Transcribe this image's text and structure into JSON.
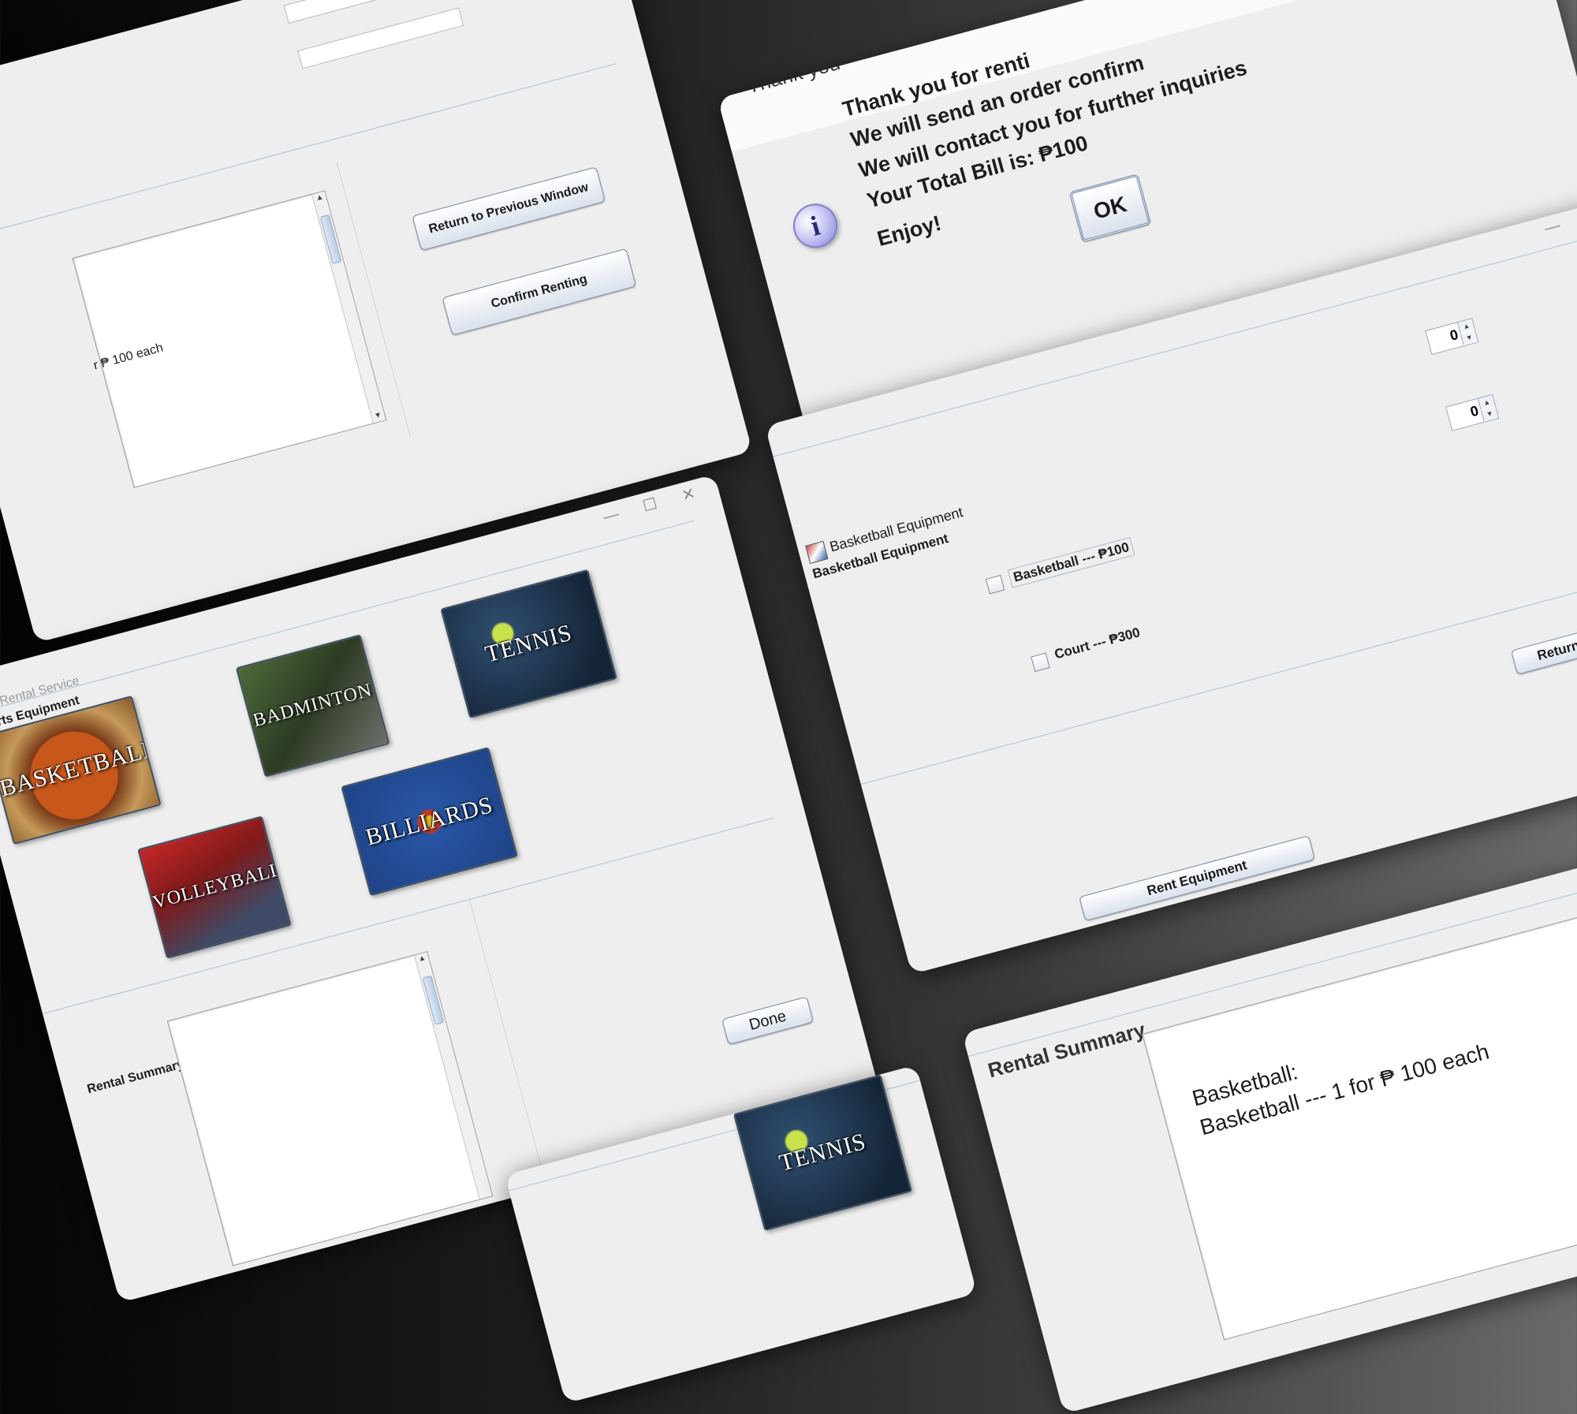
{
  "windows": {
    "customer_form": {
      "buttons": {
        "return_label": "Return to Previous Window",
        "confirm_label": "Confirm Renting"
      },
      "summary_fragment": "r ₱ 100 each"
    },
    "dialog": {
      "title_fragment": "Thank you",
      "lines": [
        "Thank you for renti",
        "We will send an order confirm",
        "We will contact you for further inquiries",
        "Your Total Bill is: ₱100",
        "Enjoy!"
      ],
      "ok_label": "OK",
      "icon": "info-icon"
    },
    "main_menu": {
      "title_fragment": "ment Rental Service",
      "group_label": "Sports Equipment",
      "tiles": [
        "BASKETBALL",
        "BADMINTON",
        "TENNIS",
        "VOLLEYBALL",
        "BILLIARDS"
      ],
      "summary_label": "Rental Summary",
      "done_label": "Done"
    },
    "basketball": {
      "title": "Basketball Equipment",
      "group_label": "Basketball Equipment",
      "items": [
        {
          "label": "Basketball --- ₱100",
          "qty": "0"
        },
        {
          "label": "Court --- ₱300",
          "qty": "0"
        }
      ],
      "rent_label": "Rent Equipment",
      "return_label": "Return to Previo"
    },
    "summary_zoom": {
      "label": "Rental Summary",
      "line1": "Basketball:",
      "line2": "Basketball  --- 1 for ₱ 100 each"
    },
    "bottom_fragment": {
      "tile": "TENNIS"
    }
  },
  "colors": {
    "window_bg": "#eeeeee",
    "group_line": "#a8c0dc",
    "button_gradient_top": "#ffffff",
    "button_gradient_bottom": "#d9e1ec"
  }
}
